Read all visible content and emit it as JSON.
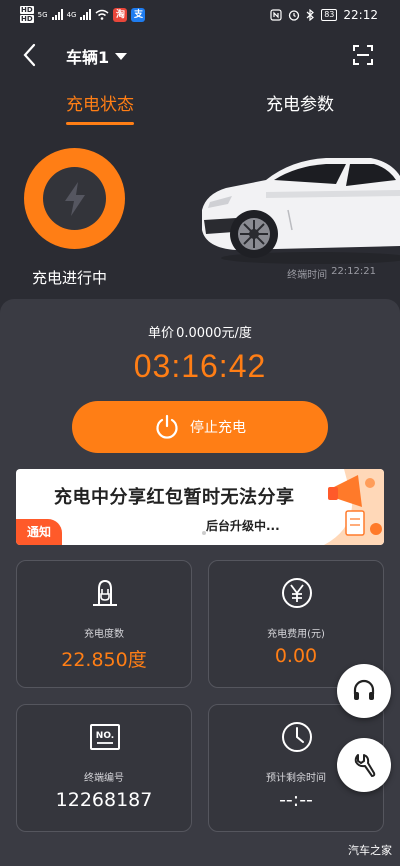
{
  "statusbar": {
    "hd1": "HD",
    "hd2": "HD",
    "net1": "5G",
    "net2": "4G",
    "time": "22:12",
    "battery": "83"
  },
  "nav": {
    "vehicle": "车辆1"
  },
  "tabs": {
    "status": "充电状态",
    "params": "充电参数"
  },
  "charging": {
    "state_label": "充电进行中",
    "terminal_time_label": "终端时间",
    "terminal_time": "22:12:21"
  },
  "session": {
    "price_label": "单价",
    "price_value": "0.0000元/度",
    "elapsed": "03:16:42",
    "stop_label": "停止充电"
  },
  "banner": {
    "headline": "充电中分享红包暂时无法分享",
    "sub": "后台升级中...",
    "tag": "通知"
  },
  "stats": {
    "energy_label": "充电度数",
    "energy_value": "22.850度",
    "fee_label": "充电费用(元)",
    "fee_value": "0.00",
    "terminal_no_label": "终端编号",
    "terminal_no_value": "12268187",
    "remaining_label": "预计剩余时间",
    "remaining_value": "--:--",
    "no_icon_text": "NO."
  },
  "watermark": "汽车之家",
  "colors": {
    "accent": "#ff7e15",
    "background": "#2b2c33",
    "panel": "#3a3b43"
  },
  "icons": [
    "back-arrow-icon",
    "caret-down-icon",
    "scan-icon",
    "lightning-icon",
    "power-icon",
    "plug-icon",
    "yuan-icon",
    "terminal-number-icon",
    "clock-icon",
    "headset-icon",
    "wrench-icon"
  ]
}
